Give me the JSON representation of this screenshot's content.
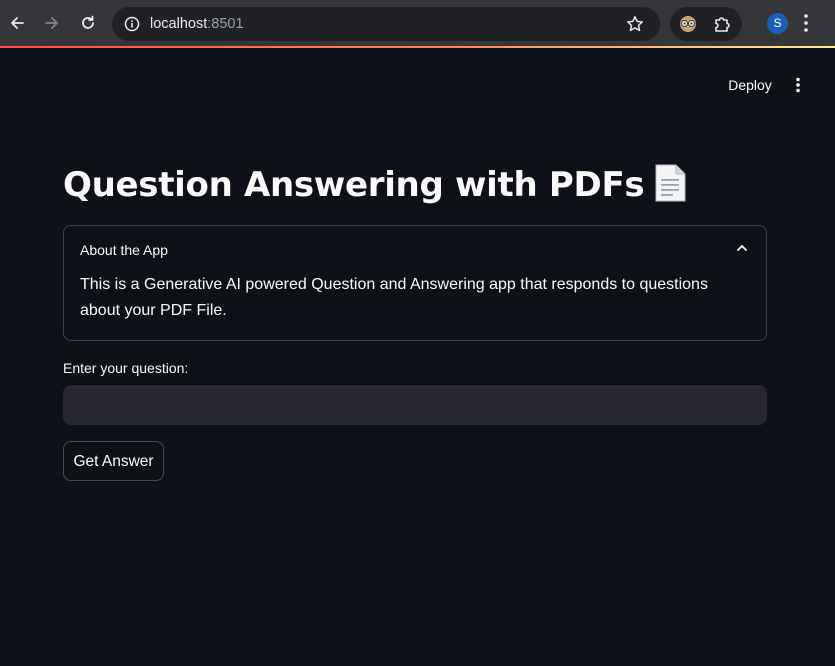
{
  "browser": {
    "url_host": "localhost",
    "url_port": ":8501",
    "profile_initial": "S"
  },
  "header": {
    "deploy_label": "Deploy"
  },
  "main": {
    "title": "Question Answering with PDFs",
    "title_icon": "document-icon"
  },
  "expander": {
    "label": "About the App",
    "expanded": true,
    "body": "This is a Generative AI powered Question and Answering app that responds to questions about your PDF File."
  },
  "question": {
    "label": "Enter your question:",
    "value": "",
    "placeholder": ""
  },
  "actions": {
    "get_answer_label": "Get Answer"
  },
  "colors": {
    "background": "#0e1117",
    "input_background": "#262730",
    "text": "#fafafa",
    "chrome": "#35363a",
    "profile": "#1a5fb4"
  }
}
